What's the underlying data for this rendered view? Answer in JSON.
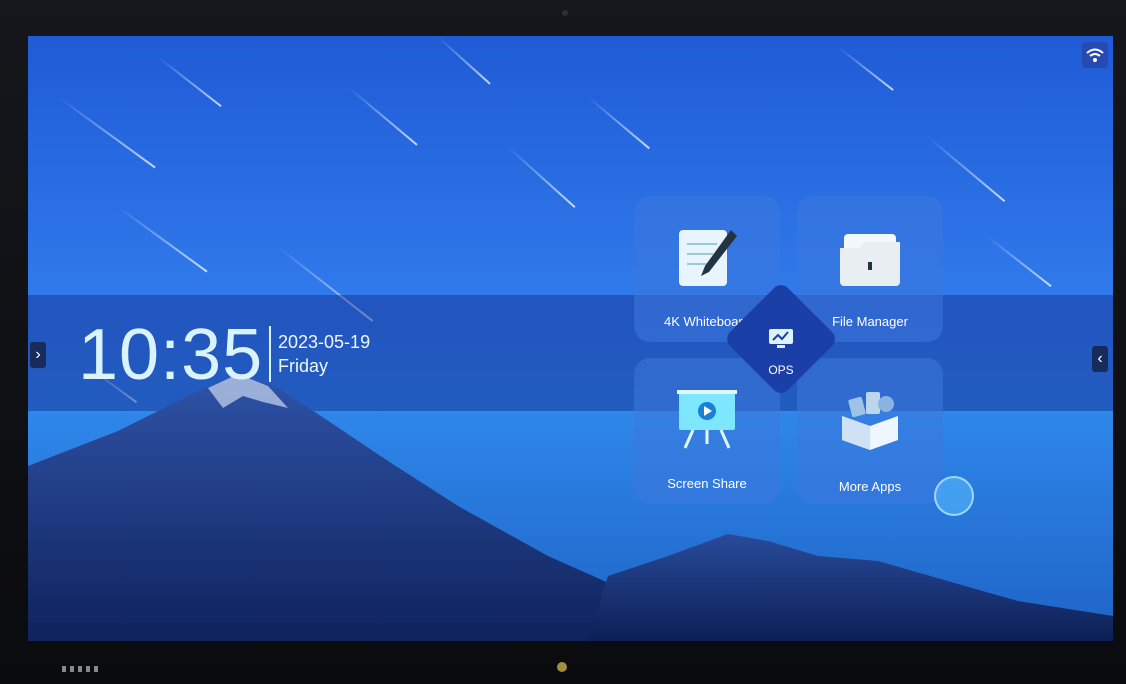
{
  "clock": {
    "time": "10:35",
    "date": "2023-05-19",
    "day": "Friday"
  },
  "tiles": [
    {
      "label": "4K Whiteboard",
      "icon": "whiteboard-icon"
    },
    {
      "label": "File Manager",
      "icon": "folder-icon"
    },
    {
      "label": "Screen Share",
      "icon": "presentation-icon"
    },
    {
      "label": "More Apps",
      "icon": "apps-box-icon"
    }
  ],
  "ops": {
    "label": "OPS",
    "icon": "monitor-icon"
  },
  "status": {
    "wifi_icon": "wifi-icon"
  },
  "nav": {
    "left_arrow": "›",
    "right_arrow": "‹"
  },
  "colors": {
    "tile_bg": "#3c78dc",
    "ops_bg": "#1a3fa6",
    "screen_top": "#1f5bd6",
    "screen_bottom": "#1e63c6"
  }
}
